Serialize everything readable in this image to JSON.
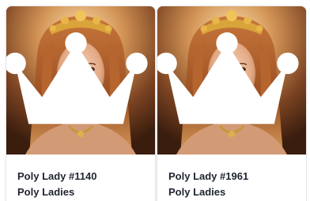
{
  "cards": [
    {
      "name": "Poly Lady #1140",
      "collection": "Poly Ladies",
      "badge_icon": "crown-icon",
      "image": "portrait of woman with golden tiara"
    },
    {
      "name": "Poly Lady #1961",
      "collection": "Poly Ladies",
      "badge_icon": "crown-icon",
      "image": "portrait of woman with golden tiara"
    }
  ],
  "colors": {
    "text": "#1f2430",
    "badge": "#ffffff",
    "card_border": "#e6e8ec"
  }
}
